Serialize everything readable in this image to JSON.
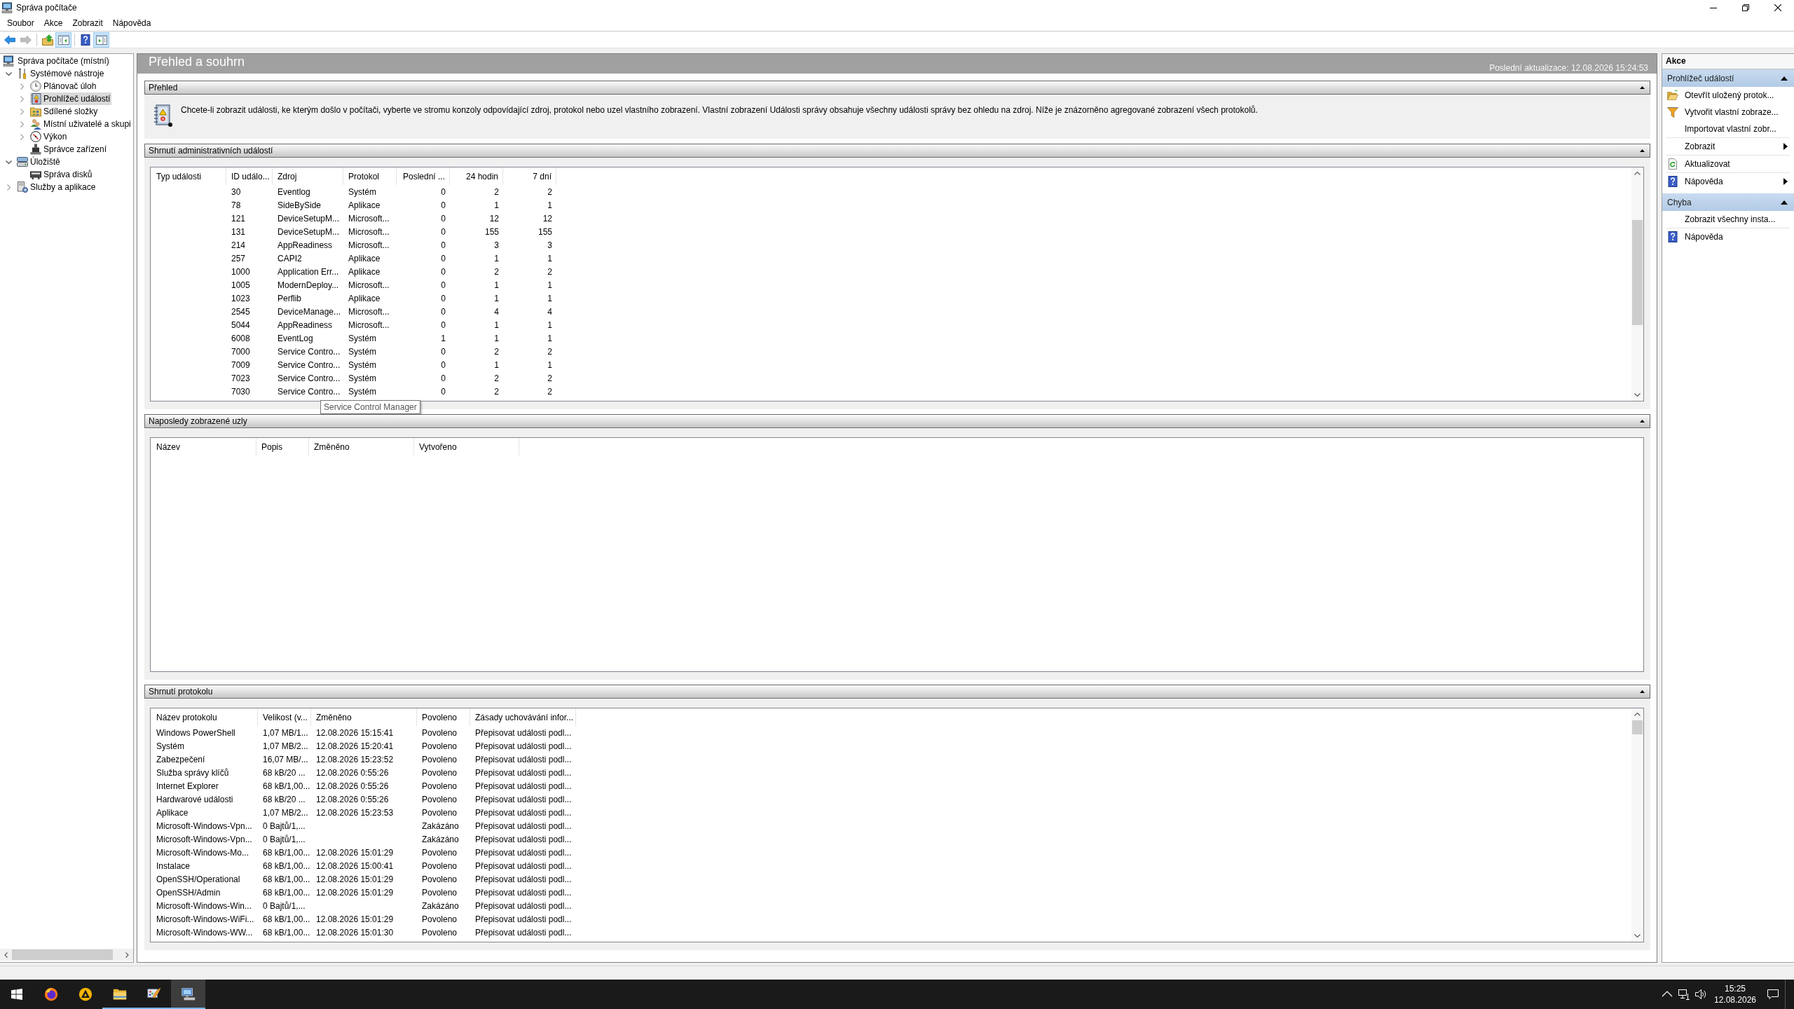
{
  "window": {
    "title": "Správa počítače"
  },
  "menu": [
    {
      "label": "Soubor"
    },
    {
      "label": "Akce"
    },
    {
      "label": "Zobrazit"
    },
    {
      "label": "Nápověda"
    }
  ],
  "toolbar": [
    {
      "buttons": [
        {
          "kind": "back",
          "disabled": false,
          "pressed": false
        },
        {
          "kind": "forward",
          "disabled": true,
          "pressed": false
        }
      ]
    },
    {
      "buttons": [
        {
          "kind": "up",
          "disabled": false,
          "pressed": false
        },
        {
          "kind": "console-tree",
          "disabled": false,
          "pressed": true
        }
      ]
    },
    {
      "buttons": [
        {
          "kind": "help",
          "disabled": false,
          "pressed": false
        },
        {
          "kind": "action-pane",
          "disabled": false,
          "pressed": true
        }
      ]
    }
  ],
  "tree": [
    {
      "label": "Správa počítače (místní)",
      "kind": "computer",
      "selected": false,
      "children": [
        {
          "label": "Systémové nástroje",
          "kind": "tools",
          "expanded": true,
          "selected": false,
          "children": [
            {
              "label": "Plánovač úloh",
              "kind": "clock",
              "expanded": false,
              "selected": false
            },
            {
              "label": "Prohlížeč událostí",
              "kind": "event-log",
              "expanded": false,
              "selected": true
            },
            {
              "label": "Sdílené složky",
              "kind": "shared-folder",
              "expanded": false,
              "selected": false
            },
            {
              "label": "Místní uživatelé a skupi",
              "kind": "users",
              "expanded": false,
              "selected": false
            },
            {
              "label": "Výkon",
              "kind": "performance",
              "expanded": false,
              "selected": false
            },
            {
              "label": "Správce zařízení",
              "kind": "device",
              "selected": false
            }
          ]
        },
        {
          "label": "Úložiště",
          "kind": "storage",
          "expanded": true,
          "selected": false,
          "children": [
            {
              "label": "Správa disků",
              "kind": "disk",
              "selected": false
            }
          ]
        },
        {
          "label": "Služby a aplikace",
          "kind": "services",
          "expanded": false,
          "selected": false
        }
      ]
    }
  ],
  "content": {
    "title": "Přehled a souhrn",
    "last_update": "Poslední aktualizace: 12.08.2026 15:24:53",
    "sections": [
      {
        "kind": "text",
        "title": "Přehled",
        "expanded": true,
        "text": "Chcete-li zobrazit události, ke kterým došlo v počítači, vyberte ve stromu konzoly odpovídající zdroj, protokol nebo uzel vlastního zobrazení. Vlastní zobrazení Události správy obsahuje všechny události správy bez ohledu na zdroj. Níže je znázorněno agregované zobrazení všech protokolů."
      },
      {
        "kind": "table",
        "title": "Shrnutí administrativních událostí",
        "expanded": true,
        "columns": [
          {
            "label": "Typ události",
            "kind": "text"
          },
          {
            "label": "ID událo...",
            "kind": "text"
          },
          {
            "label": "Zdroj",
            "kind": "text"
          },
          {
            "label": "Protokol",
            "kind": "text"
          },
          {
            "label": "Poslední ...",
            "kind": "number"
          },
          {
            "label": "24 hodin",
            "kind": "number"
          },
          {
            "label": "7 dní",
            "kind": "number"
          }
        ],
        "rows": [
          [
            null,
            "30",
            "Eventlog",
            "Systém",
            "0",
            "2",
            "2"
          ],
          [
            null,
            "78",
            "SideBySide",
            "Aplikace",
            "0",
            "1",
            "1"
          ],
          [
            null,
            "121",
            "DeviceSetupM...",
            "Microsoft...",
            "0",
            "12",
            "12"
          ],
          [
            null,
            "131",
            "DeviceSetupM...",
            "Microsoft...",
            "0",
            "155",
            "155"
          ],
          [
            null,
            "214",
            "AppReadiness",
            "Microsoft...",
            "0",
            "3",
            "3"
          ],
          [
            null,
            "257",
            "CAPI2",
            "Aplikace",
            "0",
            "1",
            "1"
          ],
          [
            null,
            "1000",
            "Application Err...",
            "Aplikace",
            "0",
            "2",
            "2"
          ],
          [
            null,
            "1005",
            "ModernDeploy...",
            "Microsoft...",
            "0",
            "1",
            "1"
          ],
          [
            null,
            "1023",
            "Perflib",
            "Aplikace",
            "0",
            "1",
            "1"
          ],
          [
            null,
            "2545",
            "DeviceManage...",
            "Microsoft...",
            "0",
            "4",
            "4"
          ],
          [
            null,
            "5044",
            "AppReadiness",
            "Microsoft...",
            "0",
            "1",
            "1"
          ],
          [
            null,
            "6008",
            "EventLog",
            "Systém",
            "1",
            "1",
            "1"
          ],
          [
            null,
            "7000",
            "Service Contro...",
            "Systém",
            "0",
            "2",
            "2"
          ],
          [
            null,
            "7009",
            "Service Contro...",
            "Systém",
            "0",
            "1",
            "1"
          ],
          [
            null,
            "7023",
            "Service Contro...",
            "Systém",
            "0",
            "2",
            "2"
          ],
          [
            null,
            "7030",
            "Service Contro...",
            "Systém",
            "0",
            "2",
            "2"
          ]
        ],
        "tooltip": "Service Control Manager"
      },
      {
        "kind": "table",
        "title": "Naposledy zobrazené uzly",
        "expanded": true,
        "columns": [
          {
            "label": "Název",
            "kind": "text"
          },
          {
            "label": "Popis",
            "kind": "text"
          },
          {
            "label": "Změněno",
            "kind": "text"
          },
          {
            "label": "Vytvořeno",
            "kind": "text"
          }
        ]
      },
      {
        "kind": "table",
        "title": "Shrnutí protokolu",
        "expanded": true,
        "columns": [
          {
            "label": "Název protokolu",
            "kind": "text"
          },
          {
            "label": "Velikost (v...",
            "kind": "text"
          },
          {
            "label": "Změněno",
            "kind": "text"
          },
          {
            "label": "Povoleno",
            "kind": "text"
          },
          {
            "label": "Zásady uchovávání infor...",
            "kind": "text"
          }
        ],
        "rows": [
          [
            "Windows PowerShell",
            "1,07 MB/1...",
            "12.08.2026 15:15:41",
            "Povoleno",
            "Přepisovat události podl..."
          ],
          [
            "Systém",
            "1,07 MB/2...",
            "12.08.2026 15:20:41",
            "Povoleno",
            "Přepisovat události podl..."
          ],
          [
            "Zabezpečení",
            "16,07 MB/...",
            "12.08.2026 15:23:52",
            "Povoleno",
            "Přepisovat události podl..."
          ],
          [
            "Služba správy klíčů",
            "68 kB/20 ...",
            "12.08.2026 0:55:26",
            "Povoleno",
            "Přepisovat události podl..."
          ],
          [
            "Internet Explorer",
            "68 kB/1,00...",
            "12.08.2026 0:55:26",
            "Povoleno",
            "Přepisovat události podl..."
          ],
          [
            "Hardwarové události",
            "68 kB/20 ...",
            "12.08.2026 0:55:26",
            "Povoleno",
            "Přepisovat události podl..."
          ],
          [
            "Aplikace",
            "1,07 MB/2...",
            "12.08.2026 15:23:53",
            "Povoleno",
            "Přepisovat události podl..."
          ],
          [
            "Microsoft-Windows-Vpn...",
            "0 Bajtů/1,...",
            null,
            "Zakázáno",
            "Přepisovat události podl..."
          ],
          [
            "Microsoft-Windows-Vpn...",
            "0 Bajtů/1,...",
            null,
            "Zakázáno",
            "Přepisovat události podl..."
          ],
          [
            "Microsoft-Windows-Mo...",
            "68 kB/1,00...",
            "12.08.2026 15:01:29",
            "Povoleno",
            "Přepisovat události podl..."
          ],
          [
            "Instalace",
            "68 kB/1,00...",
            "12.08.2026 15:00:41",
            "Povoleno",
            "Přepisovat události podl..."
          ],
          [
            "OpenSSH/Operational",
            "68 kB/1,00...",
            "12.08.2026 15:01:29",
            "Povoleno",
            "Přepisovat události podl..."
          ],
          [
            "OpenSSH/Admin",
            "68 kB/1,00...",
            "12.08.2026 15:01:29",
            "Povoleno",
            "Přepisovat události podl..."
          ],
          [
            "Microsoft-Windows-Win...",
            "0 Bajtů/1,...",
            null,
            "Zakázáno",
            "Přepisovat události podl..."
          ],
          [
            "Microsoft-Windows-WiFi...",
            "68 kB/1,00...",
            "12.08.2026 15:01:29",
            "Povoleno",
            "Přepisovat události podl..."
          ],
          [
            "Microsoft-Windows-WW...",
            "68 kB/1,00...",
            "12.08.2026 15:01:30",
            "Povoleno",
            "Přepisovat události podl..."
          ]
        ]
      }
    ]
  },
  "actions": {
    "title": "Akce",
    "groups": [
      {
        "title": "Prohlížeč událostí",
        "expanded": true,
        "items": [
          {
            "label": "Otevřít uložený protok...",
            "kind": "open-folder",
            "submenu": false,
            "divider_above": false
          },
          {
            "label": "Vytvořit vlastní zobraze...",
            "kind": "filter",
            "submenu": false,
            "divider_above": false
          },
          {
            "label": "Importovat vlastní zobr...",
            "kind": "plain",
            "submenu": false,
            "divider_above": false
          },
          {
            "label": "Zobrazit",
            "kind": "plain",
            "submenu": true,
            "divider_above": true
          },
          {
            "label": "Aktualizovat",
            "kind": "refresh",
            "submenu": false,
            "divider_above": true
          },
          {
            "label": "Nápověda",
            "kind": "help",
            "submenu": true,
            "divider_above": true
          }
        ]
      },
      {
        "title": "Chyba",
        "expanded": true,
        "items": [
          {
            "label": "Zobrazit všechny insta...",
            "kind": "plain",
            "submenu": false,
            "divider_above": false
          },
          {
            "label": "Nápověda",
            "kind": "help",
            "submenu": false,
            "divider_above": true
          }
        ]
      }
    ]
  },
  "taskbar": {
    "apps": [
      {
        "kind": "browser",
        "running": false,
        "selected": false
      },
      {
        "kind": "triangle",
        "running": false,
        "selected": false
      },
      {
        "kind": "folder",
        "running": true,
        "selected": false
      },
      {
        "kind": "paint",
        "running": true,
        "selected": false
      },
      {
        "kind": "computer",
        "running": true,
        "selected": true
      }
    ],
    "clock": {
      "time": "15:25",
      "date": "12.08.2026"
    }
  }
}
